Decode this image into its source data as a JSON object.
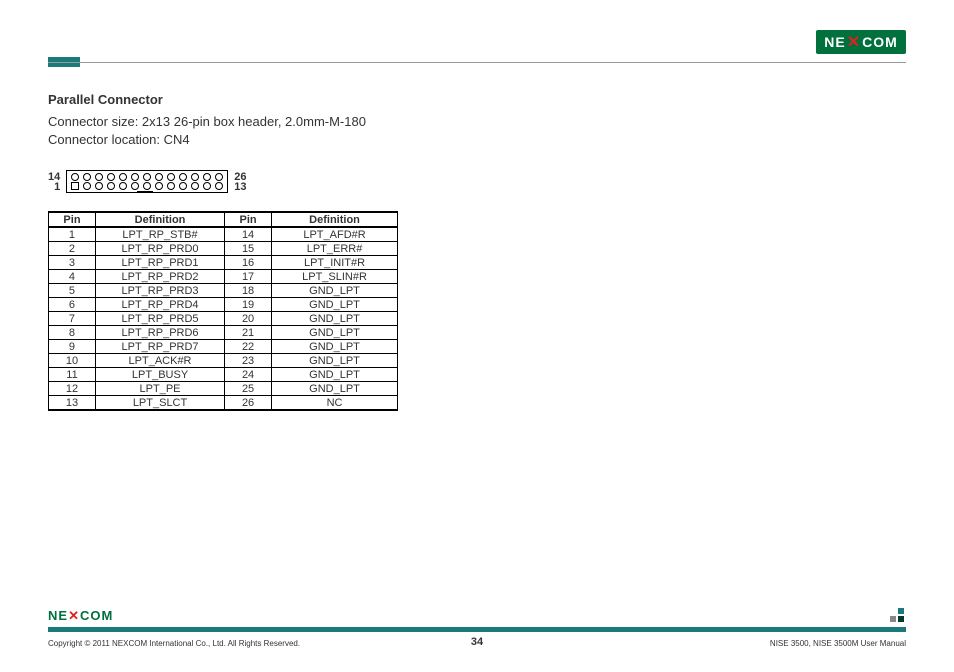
{
  "brand": "NEXCOM",
  "section": {
    "title": "Parallel Connector",
    "size_line": "Connector size:  2x13 26-pin box header, 2.0mm-M-180",
    "loc_line": "Connector location: CN4"
  },
  "diagram": {
    "top_left": "14",
    "bottom_left": "1",
    "top_right": "26",
    "bottom_right": "13"
  },
  "table": {
    "headers": {
      "pin": "Pin",
      "def": "Definition"
    },
    "rows": [
      {
        "p1": "1",
        "d1": "LPT_RP_STB#",
        "p2": "14",
        "d2": "LPT_AFD#R"
      },
      {
        "p1": "2",
        "d1": "LPT_RP_PRD0",
        "p2": "15",
        "d2": "LPT_ERR#"
      },
      {
        "p1": "3",
        "d1": "LPT_RP_PRD1",
        "p2": "16",
        "d2": "LPT_INIT#R"
      },
      {
        "p1": "4",
        "d1": "LPT_RP_PRD2",
        "p2": "17",
        "d2": "LPT_SLIN#R"
      },
      {
        "p1": "5",
        "d1": "LPT_RP_PRD3",
        "p2": "18",
        "d2": "GND_LPT"
      },
      {
        "p1": "6",
        "d1": "LPT_RP_PRD4",
        "p2": "19",
        "d2": "GND_LPT"
      },
      {
        "p1": "7",
        "d1": "LPT_RP_PRD5",
        "p2": "20",
        "d2": "GND_LPT"
      },
      {
        "p1": "8",
        "d1": "LPT_RP_PRD6",
        "p2": "21",
        "d2": "GND_LPT"
      },
      {
        "p1": "9",
        "d1": "LPT_RP_PRD7",
        "p2": "22",
        "d2": "GND_LPT"
      },
      {
        "p1": "10",
        "d1": "LPT_ACK#R",
        "p2": "23",
        "d2": "GND_LPT"
      },
      {
        "p1": "11",
        "d1": "LPT_BUSY",
        "p2": "24",
        "d2": "GND_LPT"
      },
      {
        "p1": "12",
        "d1": "LPT_PE",
        "p2": "25",
        "d2": "GND_LPT"
      },
      {
        "p1": "13",
        "d1": "LPT_SLCT",
        "p2": "26",
        "d2": "NC"
      }
    ]
  },
  "footer": {
    "copyright": "Copyright © 2011 NEXCOM International Co., Ltd. All Rights Reserved.",
    "page": "34",
    "doc": "NISE 3500, NISE 3500M User Manual"
  }
}
